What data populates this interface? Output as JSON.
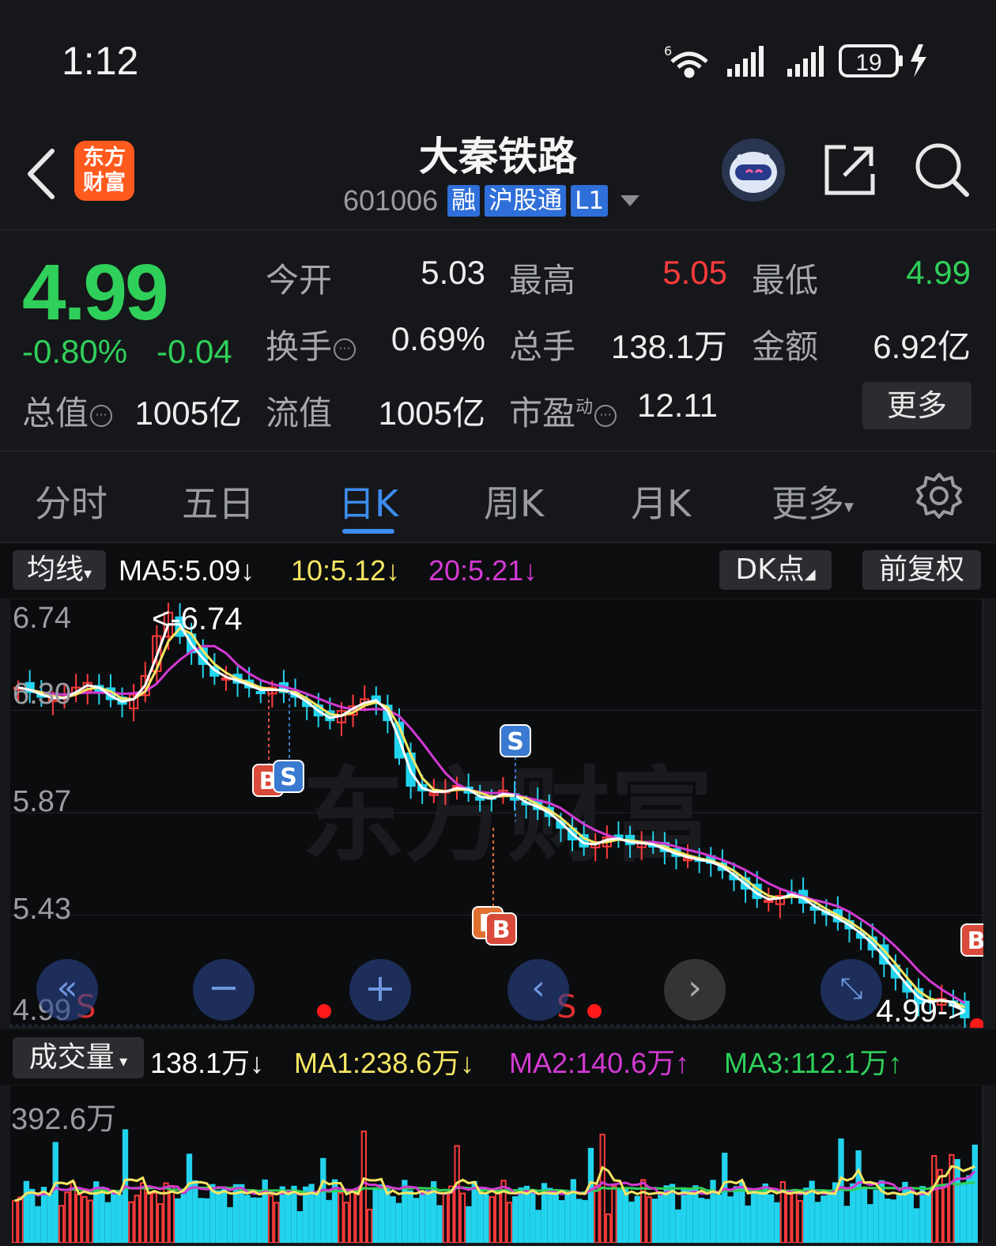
{
  "status_bar": {
    "time": "1:12",
    "battery": "19"
  },
  "header": {
    "app_logo": [
      "东方",
      "财富"
    ],
    "stock_name": "大秦铁路",
    "stock_code": "601006",
    "tags": [
      "融",
      "沪股通",
      "L1"
    ]
  },
  "quote": {
    "price": "4.99",
    "change_pct": "-0.80%",
    "change": "-0.04",
    "open_label": "今开",
    "open": "5.03",
    "high_label": "最高",
    "high": "5.05",
    "low_label": "最低",
    "low": "4.99",
    "turnover_label": "换手",
    "turnover": "0.69%",
    "volume_label": "总手",
    "volume": "138.1万",
    "amount_label": "金额",
    "amount": "6.92亿",
    "mktcap_label": "总值",
    "mktcap": "1005亿",
    "float_label": "流值",
    "float_cap": "1005亿",
    "pe_label": "市盈",
    "pe_sup": "动",
    "pe": "12.11",
    "more": "更多"
  },
  "tabs": [
    "分时",
    "五日",
    "日K",
    "周K",
    "月K",
    "更多"
  ],
  "active_tab": "日K",
  "indicator": {
    "selector": "均线",
    "ma5": "MA5:5.09↓",
    "ma10": "10:5.12↓",
    "ma20": "20:5.21↓",
    "dk": "DK点",
    "adjust": "前复权"
  },
  "price_axis": [
    "6.74",
    "6.30",
    "5.87",
    "5.43",
    "4.99"
  ],
  "annotations": {
    "high_marker": "<-6.74",
    "last_marker": "4.99->"
  },
  "volume_bar": {
    "selector": "成交量",
    "value": "138.1万↓",
    "ma1": "MA1:238.6万↓",
    "ma2": "MA2:140.6万↑",
    "ma3": "MA3:112.1万↑",
    "axis_max": "392.6万"
  },
  "colors": {
    "up": "#ff3b3b",
    "down": "#22d3ee",
    "green": "#2fd05a",
    "ma5": "#ffffff",
    "ma10": "#f5e663",
    "ma20": "#d23ad2",
    "accent": "#3d8cf0"
  },
  "chart_data": {
    "type": "candlestick",
    "y_range": [
      4.99,
      6.74
    ],
    "close_sampled": [
      6.4,
      6.38,
      6.36,
      6.35,
      6.36,
      6.4,
      6.42,
      6.38,
      6.35,
      6.33,
      6.37,
      6.45,
      6.62,
      6.72,
      6.62,
      6.55,
      6.5,
      6.45,
      6.44,
      6.42,
      6.4,
      6.38,
      6.4,
      6.38,
      6.36,
      6.32,
      6.28,
      6.26,
      6.3,
      6.32,
      6.35,
      6.34,
      6.26,
      6.1,
      5.98,
      5.96,
      5.95,
      5.96,
      5.98,
      5.95,
      5.92,
      5.93,
      5.96,
      5.92,
      5.9,
      5.88,
      5.85,
      5.8,
      5.75,
      5.72,
      5.74,
      5.76,
      5.75,
      5.73,
      5.74,
      5.72,
      5.7,
      5.68,
      5.67,
      5.66,
      5.65,
      5.62,
      5.58,
      5.54,
      5.5,
      5.49,
      5.51,
      5.52,
      5.48,
      5.45,
      5.43,
      5.4,
      5.37,
      5.33,
      5.28,
      5.22,
      5.16,
      5.1,
      5.05,
      5.06,
      5.07,
      5.04,
      4.99
    ],
    "ma5": "5.09",
    "ma10": "5.12",
    "ma20": "5.21",
    "volume_max": "392.6万"
  }
}
